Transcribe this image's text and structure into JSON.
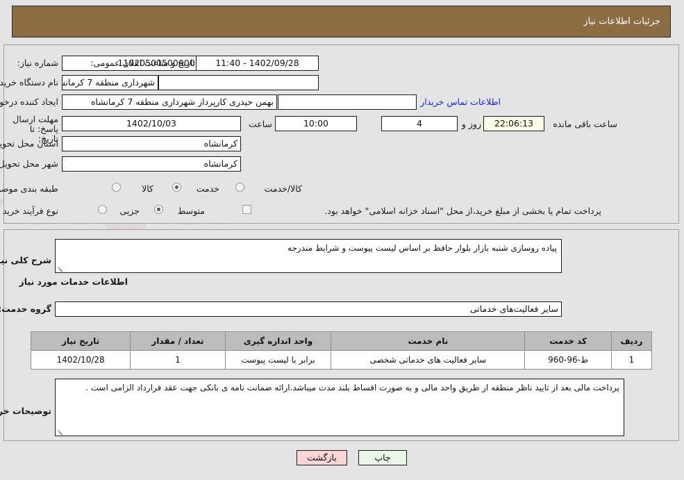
{
  "header": {
    "title": "جزئیات اطلاعات نیاز"
  },
  "watermark": {
    "text": "AriaTender.net"
  },
  "form": {
    "need_number": {
      "label": "شماره نیاز:",
      "value": "1102050050000078"
    },
    "announce_datetime": {
      "label": "تاریخ و ساعت اعلان عمومی:",
      "value": "1402/09/28 - 11:40"
    },
    "buyer_org": {
      "label": "نام دستگاه خریدار:",
      "value": "شهرداری منطقه 7 کرمانشاه"
    },
    "creator": {
      "label": "ایجاد کننده درخواست:",
      "value": "بهمن حیدری کارپرداز شهرداری منطقه 7 کرمانشاه"
    },
    "buyer_contact_link": "اطلاعات تماس خریدار",
    "empty_field": {
      "value": ""
    },
    "deadline": {
      "label": "مهلت ارسال پاسخ: تا تاریخ:",
      "date": "1402/10/03",
      "time_label": "ساعت",
      "time": "10:00",
      "days": "4",
      "days_label": "روز و",
      "countdown": "22:06:13",
      "countdown_label": "ساعت باقی مانده"
    },
    "delivery_province": {
      "label": "استان محل تحویل:",
      "value": "کرمانشاه"
    },
    "delivery_city": {
      "label": "شهر محل تحویل:",
      "value": "کرمانشاه"
    },
    "category": {
      "label": "طبقه بندی موضوعی:",
      "options": [
        "کالا",
        "خدمت",
        "کالا/خدمت"
      ],
      "selected": "خدمت"
    },
    "purchase_process": {
      "label": "نوع فرآیند خرید :",
      "options": [
        "جزیی",
        "متوسط"
      ],
      "selected": "متوسط",
      "checkbox_note": "پرداخت تمام یا بخشی از مبلغ خرید،از محل \"اسناد خزانه اسلامی\" خواهد بود.",
      "checkbox_checked": false
    }
  },
  "main": {
    "general_description": {
      "label": "شرح کلی نیاز:",
      "value": "پیاده روسازی شنبه بازار بلوار حافظ بر اساس لیست پیوست و شرایط مندرجه"
    },
    "services_section_title": "اطلاعات خدمات مورد نیاز",
    "service_group": {
      "label": "گروه خدمت:",
      "value": "سایر فعالیت‌های خدماتی"
    },
    "table": {
      "headers": [
        "ردیف",
        "کد خدمت",
        "نام خدمت",
        "واحد اندازه گیری",
        "تعداد / مقدار",
        "تاریخ نیاز"
      ],
      "rows": [
        {
          "row": "1",
          "service_code": "ط-96-960",
          "service_name": "سایر فعالیت های خدماتی شخصی",
          "unit": "برابر با لیست پیوست",
          "quantity": "1",
          "need_date": "1402/10/28"
        }
      ]
    },
    "buyer_notes": {
      "label": "توضیحات خریدار:",
      "value": "پرداخت مالی بعد از  تایید ناظر منطقه از طریق واحد مالی و به صورت اقساط بلند مدت میباشد.ارائه ضمانت نامه ی بانکی جهت عقد قرارداد الزامی است ."
    }
  },
  "footer": {
    "print_button": "چاپ",
    "back_button": "بازگشت"
  },
  "colors": {
    "header_bg": "#8b6c43",
    "page_bg": "#e4e4e4",
    "link": "#1526e0",
    "print_btn_bg": "#e9f7e7",
    "back_btn_bg": "#fcd6d6",
    "table_header_bg": "#bcbcbc",
    "countdown_bg": "#fbfbe8"
  }
}
